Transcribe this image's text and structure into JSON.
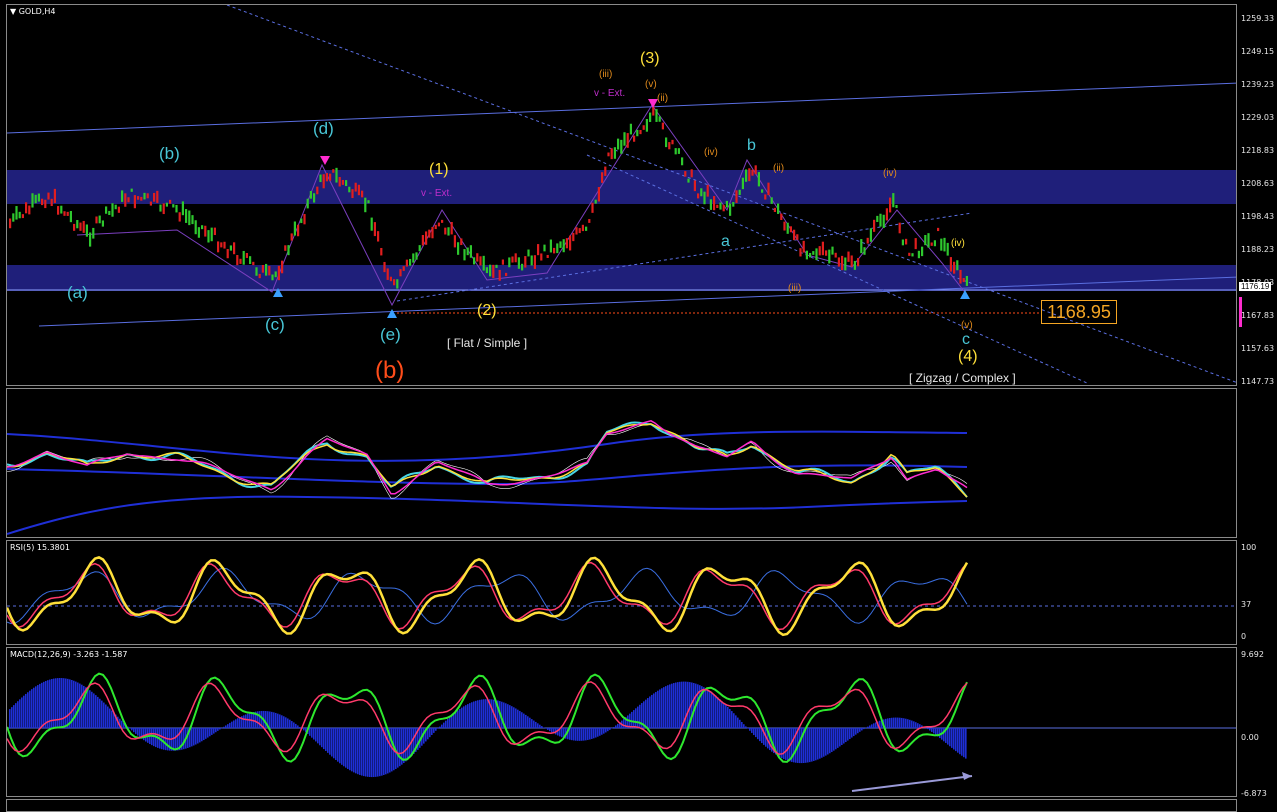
{
  "symbol_label": "GOLD,H4",
  "price_scale": [
    "1259.33",
    "1249.15",
    "1239.23",
    "1229.03",
    "1218.83",
    "1208.63",
    "1198.43",
    "1188.23",
    "1178.03",
    "1167.83",
    "1157.63",
    "1147.73"
  ],
  "current_price": "1176.19",
  "target_price": "1168.95",
  "pattern_labels": {
    "flat": "[ Flat / Simple ]",
    "zigzag": "[ Zigzag / Complex ]"
  },
  "wave_labels": {
    "a_lower": "(a)",
    "b_lower": "(b)",
    "c_lower": "(c)",
    "d_lower": "(d)",
    "e_lower": "(e)",
    "b_big": "(b)",
    "w1": "(1)",
    "w2": "(2)",
    "w3": "(3)",
    "w4": "(4)",
    "ext1": "v - Ext.",
    "ext3": "v - Ext.",
    "a_up": "a",
    "b_up": "b",
    "c_up": "c",
    "iii_top": "(iii)",
    "v_top": "(v)",
    "ii_top": "(ii)",
    "iv_mid": "(iv)",
    "i_mid": "(i)",
    "iv_right": "(iv)",
    "ii_right": "(ii)",
    "iii_right": "(iii)",
    "v_right": "(v)",
    "ii_small": "(ii)",
    "iv_small": "(iv)"
  },
  "rsi": {
    "label": "RSI(5) 15.3801",
    "scale": [
      "100",
      "37",
      "0"
    ]
  },
  "macd": {
    "label": "MACD(12,26,9) -3.263 -1.587",
    "scale": [
      "9.692",
      "0.00",
      "-6.873"
    ]
  },
  "colors": {
    "band": "#1f1f7a",
    "up": "#2ec82e",
    "down": "#e01e1e",
    "channel": "#4f63d8",
    "wave_yellow": "#ffe03a",
    "wave_cyan": "#48c6d6",
    "wave_orange": "#e08a1c",
    "wave_red": "#ff4d1a",
    "purple": "#c02ecc"
  }
}
